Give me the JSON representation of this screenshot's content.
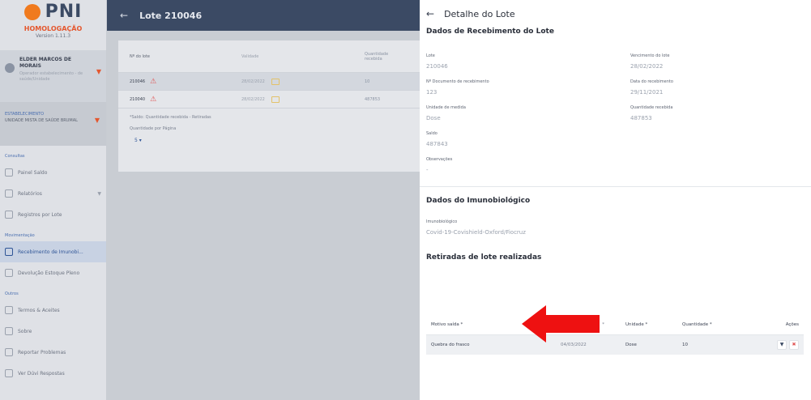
{
  "sidebar": {
    "logo_text": "PNI",
    "environment": "HOMOLOGAÇÃO",
    "version": "Version 1.11.3",
    "user_name": "ELDER MARCOS DE MORAIS",
    "user_role": "Operador estabelecimento - de saúde/Unidade",
    "estab_label": "ESTABELECIMENTO",
    "estab_value": "UNIDADE MISTA DE SAÚDE BRUMAL",
    "section_consultas": "Consultas",
    "section_movimentacao": "Movimentação",
    "section_outros": "Outros",
    "items": [
      {
        "label": "Painel Saldo"
      },
      {
        "label": "Relatórios"
      },
      {
        "label": "Registros por Lote"
      },
      {
        "label": "Recebimento de Imunobi..."
      },
      {
        "label": "Devolução Estoque Pleno"
      },
      {
        "label": "Termos & Aceites"
      },
      {
        "label": "Sobre"
      },
      {
        "label": "Reportar Problemas"
      },
      {
        "label": "Ver Dúvi Respostas"
      }
    ]
  },
  "background_page": {
    "back_icon": "arrow-left-icon",
    "title": "Lote 210046",
    "table": {
      "headers": [
        "Nº do lote",
        "Validade",
        "Quantidade recebida"
      ],
      "rows": [
        {
          "lote": "210046",
          "validade": "28/02/2022",
          "qtd": "10"
        },
        {
          "lote": "210040",
          "validade": "28/02/2022",
          "qtd": "487853"
        }
      ]
    },
    "note": "*Saldo: Quantidade recebida - Retiradas",
    "per_page_label": "Quantidade por Página",
    "per_page_value": "5"
  },
  "drawer": {
    "back_icon": "arrow-left-icon",
    "title": "Detalhe do Lote",
    "section_receb": "Dados de Recebimento do Lote",
    "fields": {
      "lote_label": "Lote",
      "lote_value": "210046",
      "venc_label": "Vencimento do lote",
      "venc_value": "28/02/2022",
      "doc_label": "Nº Documento de recebimento",
      "doc_value": "123",
      "data_receb_label": "Data do recebimento",
      "data_receb_value": "29/11/2021",
      "unid_label": "Unidade de medida",
      "unid_value": "Dose",
      "qtd_receb_label": "Quantidade recebida",
      "qtd_receb_value": "487853",
      "saldo_label": "Saldo",
      "saldo_value": "487843",
      "obs_label": "Observações",
      "obs_value": "-"
    },
    "section_imuno": "Dados do Imunobiológico",
    "imuno_label": "Imunobiológico",
    "imuno_value": "Covid-19-Covishield-Oxford/Fiocruz",
    "section_retiradas": "Retiradas de lote realizadas",
    "table": {
      "headers": {
        "motivo": "Motivo saída *",
        "data": "*",
        "unidade": "Unidade *",
        "quantidade": "Quantidade *",
        "acoes": "Ações"
      },
      "rows": [
        {
          "motivo": "Quebra do frasco",
          "data": "04/03/2022",
          "unidade": "Dose",
          "quantidade": "10"
        }
      ]
    }
  },
  "colors": {
    "annotation_arrow": "#ee1111",
    "accent": "#2f5597",
    "brand_orange": "#f07a1e"
  }
}
